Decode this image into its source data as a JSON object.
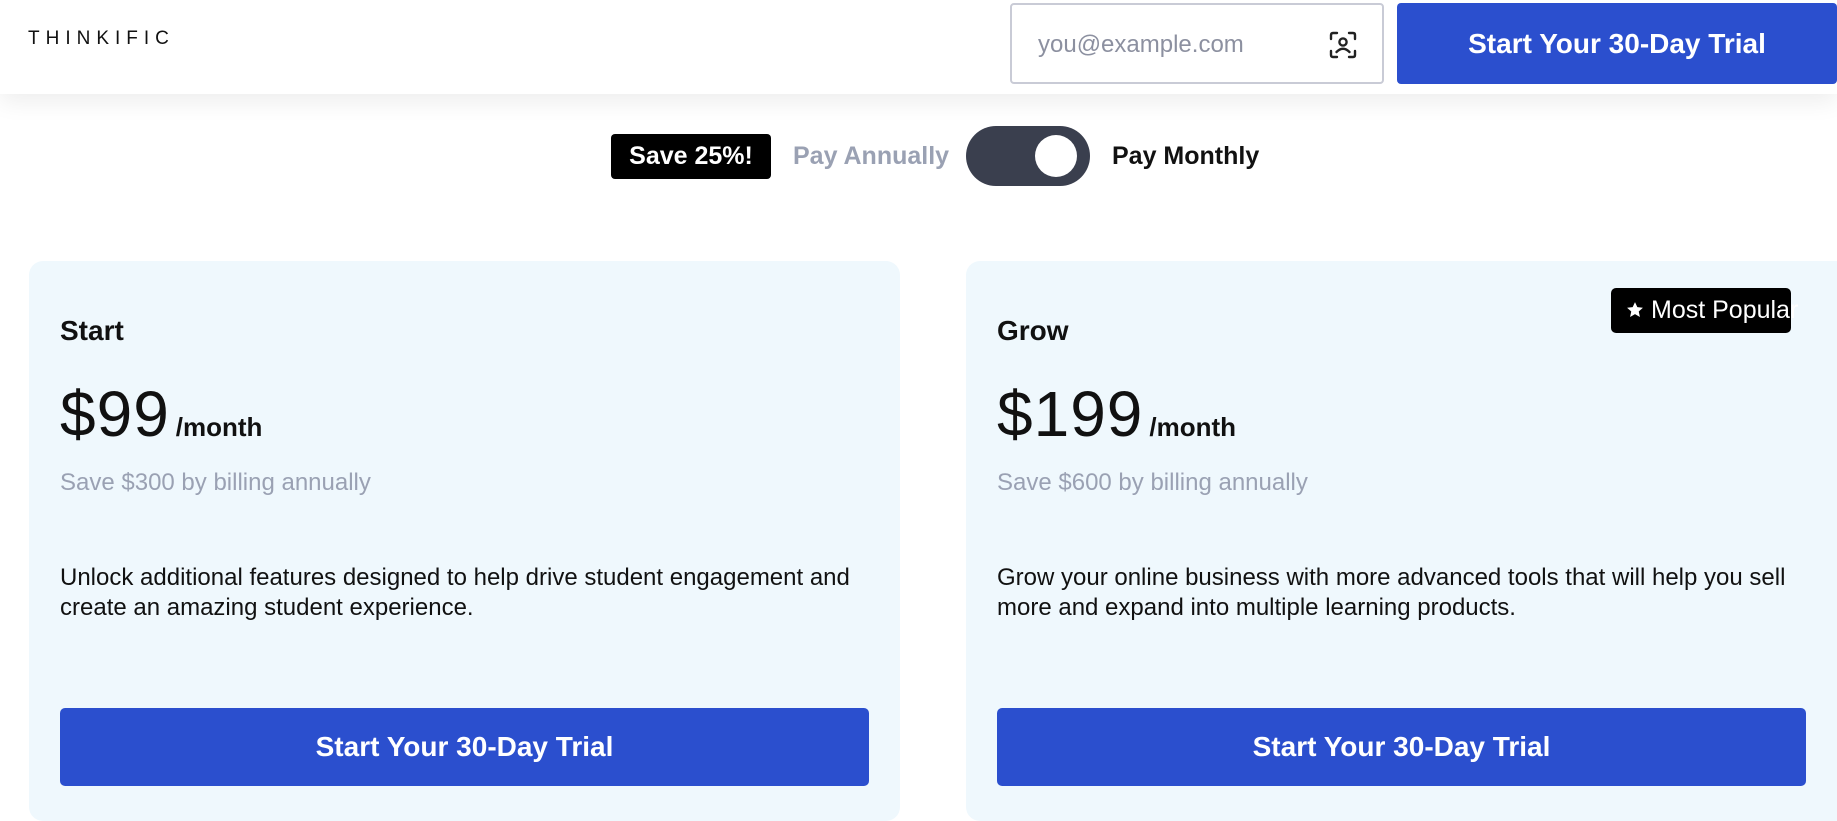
{
  "header": {
    "logo": "THINKIFIC",
    "email_placeholder": "you@example.com",
    "email_value": "",
    "cta_label": "Start Your 30-Day Trial"
  },
  "billing_toggle": {
    "badge": "Save 25%!",
    "annual_label": "Pay Annually",
    "monthly_label": "Pay Monthly",
    "selected": "monthly"
  },
  "plans": [
    {
      "name": "Start",
      "price": "$99",
      "period": "/month",
      "save_note": "Save $300 by billing annually",
      "description": "Unlock additional features designed to help drive student engagement and create an amazing student experience.",
      "cta_label": "Start Your 30-Day Trial"
    },
    {
      "name": "Grow",
      "badge": "Most Popular",
      "price": "$199",
      "period": "/month",
      "save_note": "Save $600 by billing annually",
      "description": "Grow your online business with more advanced tools that will help you sell more and expand into multiple learning products.",
      "cta_label": "Start Your 30-Day Trial"
    }
  ],
  "colors": {
    "primary": "#2b4fce",
    "card_bg": "#eff8fd",
    "muted_text": "#9aa1b3",
    "toggle_bg": "#3a3f4e",
    "badge_bg": "#000000"
  },
  "icons": {
    "email_field": "contact-scan-icon",
    "popular_badge": "star-icon"
  }
}
